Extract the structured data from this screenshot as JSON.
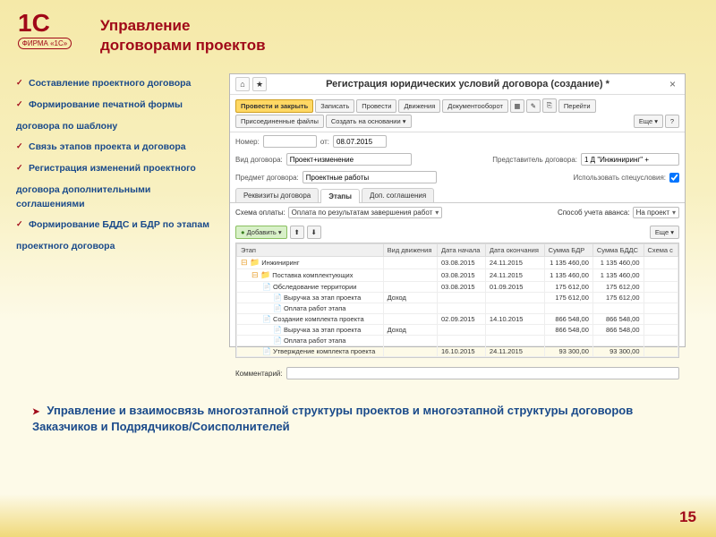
{
  "logo": {
    "main": "1C",
    "sub": "ФИРМА «1С»"
  },
  "title_line1": "Управление",
  "title_line2": "договорами проектов",
  "sidebar": {
    "items": [
      "Составление проектного договора",
      "Формирование печатной формы",
      "Связь этапов проекта и договора",
      "Регистрация изменений проектного",
      "Формирование БДДС и БДР по этапам"
    ],
    "sub1": "договора по шаблону",
    "sub2": "договора дополнительными соглашениями",
    "sub3": "проектного договора"
  },
  "ss": {
    "home": "⌂",
    "star": "★",
    "title": "Регистрация юридических условий договора (создание) *",
    "close": "×",
    "toolbar": {
      "provesti": "Провести и закрыть",
      "zapisat": "Записать",
      "provest": "Провести",
      "dvizh": "Движения",
      "doco": "Документооборот",
      "pereyti": "Перейти",
      "prisoed": "Присоединенные файлы",
      "sozdat": "Создать на основании ▾",
      "eshe": "Еще ▾",
      "help": "?"
    },
    "form": {
      "num_lbl": "Номер:",
      "ot_lbl": "от:",
      "ot_val": "08.07.2015",
      "vid_lbl": "Вид договора:",
      "vid_val": "Проект+изменение",
      "predst_lbl": "Представитель договора:",
      "predst_val": "1 Д \"Инжиниринг\" +",
      "predmet_lbl": "Предмет договора:",
      "predmet_val": "Проектные работы",
      "use_specials_lbl": "Использовать спецусловия:"
    },
    "tabs": {
      "t1": "Реквизиты договора",
      "t2": "Этапы",
      "t3": "Доп. соглашения"
    },
    "sub": {
      "shema_lbl": "Схема оплаты:",
      "shema_val": "Оплата по результатам завершения работ",
      "sposob_lbl": "Способ учета аванса:",
      "sposob_val": "На проект",
      "add": "Добавить ▾",
      "eshe": "Еще ▾"
    },
    "cols": [
      "Этап",
      "Вид движения",
      "Дата начала",
      "Дата окончания",
      "Сумма БДР",
      "Сумма БДДС",
      "Схема с"
    ],
    "rows": [
      {
        "ind": 0,
        "name": "Инжиниринг",
        "type": "",
        "d1": "03.08.2015",
        "d2": "24.11.2015",
        "s1": "1 135 460,00",
        "s2": "1 135 460,00",
        "icon": "folder"
      },
      {
        "ind": 1,
        "name": "Поставка комплектующих",
        "type": "",
        "d1": "03.08.2015",
        "d2": "24.11.2015",
        "s1": "1 135 460,00",
        "s2": "1 135 460,00",
        "icon": "folder"
      },
      {
        "ind": 2,
        "name": "Обследование территории",
        "type": "",
        "d1": "03.08.2015",
        "d2": "01.09.2015",
        "s1": "175 612,00",
        "s2": "175 612,00",
        "icon": "doc"
      },
      {
        "ind": 3,
        "name": "Выручка за этап проекта",
        "type": "Доход",
        "d1": "",
        "d2": "",
        "s1": "175 612,00",
        "s2": "175 612,00",
        "icon": "doc"
      },
      {
        "ind": 3,
        "name": "Оплата работ этапа",
        "type": "",
        "d1": "",
        "d2": "",
        "s1": "",
        "s2": "",
        "icon": "doc"
      },
      {
        "ind": 2,
        "name": "Создание комплекта проекта",
        "type": "",
        "d1": "02.09.2015",
        "d2": "14.10.2015",
        "s1": "866 548,00",
        "s2": "866 548,00",
        "icon": "doc"
      },
      {
        "ind": 3,
        "name": "Выручка за этап проекта",
        "type": "Доход",
        "d1": "",
        "d2": "",
        "s1": "866 548,00",
        "s2": "866 548,00",
        "icon": "doc"
      },
      {
        "ind": 3,
        "name": "Оплата работ этапа",
        "type": "",
        "d1": "",
        "d2": "",
        "s1": "",
        "s2": "",
        "icon": "doc"
      },
      {
        "ind": 2,
        "name": "Утверждение комплекта проекта",
        "type": "",
        "d1": "16.10.2015",
        "d2": "24.11.2015",
        "s1": "93 300,00",
        "s2": "93 300,00",
        "icon": "doc"
      }
    ],
    "comment_lbl": "Комментарий:"
  },
  "bottom": "Управление и взаимосвязь многоэтапной структуры проектов и многоэтапной структуры договоров Заказчиков и Подрядчиков/Соисполнителей",
  "page": "15"
}
